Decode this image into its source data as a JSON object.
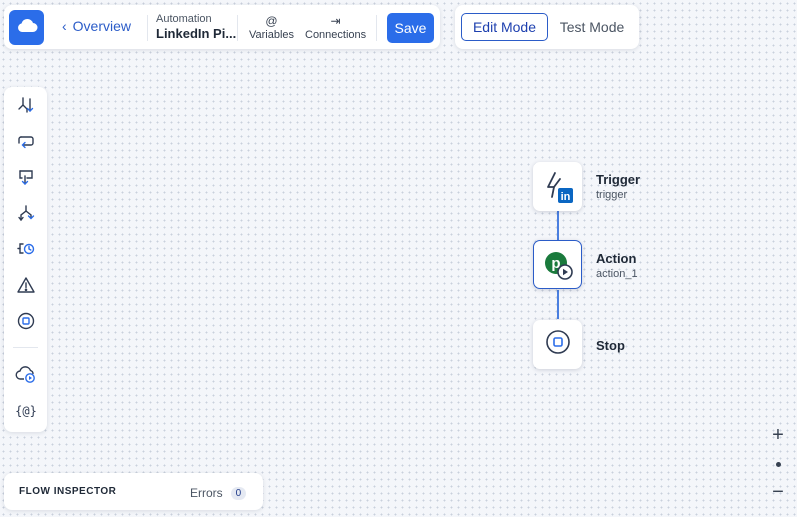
{
  "header": {
    "logo_icon": "cloud-icon",
    "back_label": "Overview",
    "crumb_label": "Automation",
    "crumb_title": "LinkedIn Pi...",
    "variables_glyph": "@",
    "variables_label": "Variables",
    "connections_glyph": "⇥",
    "connections_label": "Connections",
    "save_label": "Save"
  },
  "modes": {
    "edit_label": "Edit Mode",
    "test_label": "Test Mode",
    "active": "Edit Mode"
  },
  "toolbar": {
    "items": [
      {
        "icon": "branch-icon"
      },
      {
        "icon": "loop-icon"
      },
      {
        "icon": "return-icon"
      },
      {
        "icon": "split-icon"
      },
      {
        "icon": "wait-icon"
      },
      {
        "icon": "warning-icon"
      },
      {
        "icon": "stop-icon"
      },
      {
        "icon": "cloud-run-icon"
      },
      {
        "icon": "variable-icon",
        "glyph": "{@}"
      }
    ]
  },
  "flow": {
    "nodes": [
      {
        "title": "Trigger",
        "subtitle": "trigger",
        "icon": "linkedin-trigger-icon",
        "badge": "in"
      },
      {
        "title": "Action",
        "subtitle": "action_1",
        "icon": "pipedrive-action-icon",
        "badge": "p",
        "selected": true
      },
      {
        "title": "Stop",
        "subtitle": "",
        "icon": "stop-icon"
      }
    ]
  },
  "zoom": {
    "in_label": "+",
    "out_label": "−"
  },
  "inspector": {
    "title": "FLOW INSPECTOR",
    "errors_label": "Errors",
    "errors_count": "0"
  },
  "colors": {
    "accent": "#2b6de9",
    "link": "#2b5cc8",
    "connector": "#4a7fe0",
    "linkedin": "#0a66c2",
    "pipedrive": "#1a7a3c",
    "canvas": "#f4f6fa"
  }
}
